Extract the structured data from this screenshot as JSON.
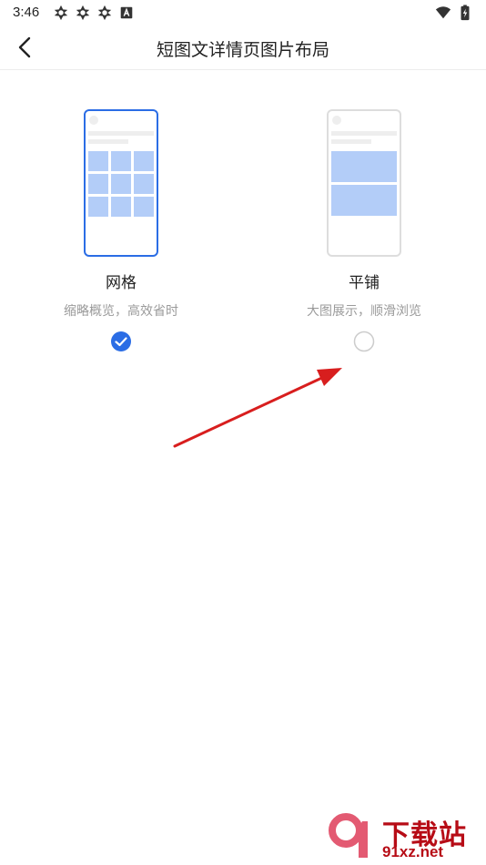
{
  "status_bar": {
    "time": "3:46",
    "left_icons": [
      "vpn-shield-icon",
      "vpn-shield-icon",
      "vpn-shield-icon",
      "font-a-icon"
    ],
    "right_icons": [
      "wifi-icon",
      "battery-charging-icon"
    ]
  },
  "header": {
    "back_icon": "chevron-left-icon",
    "title": "短图文详情页图片布局"
  },
  "options": [
    {
      "label": "网格",
      "desc": "缩略概览，高效省时",
      "selected": true
    },
    {
      "label": "平铺",
      "desc": "大图展示，顺滑浏览",
      "selected": false
    }
  ],
  "colors": {
    "accent": "#2b6de5",
    "image_placeholder": "#b3cdf8",
    "line_placeholder": "#eeeeee",
    "annotation_arrow": "#d81e1e"
  },
  "watermark": {
    "big_text": "下载站",
    "small_text": "91xz.net"
  }
}
